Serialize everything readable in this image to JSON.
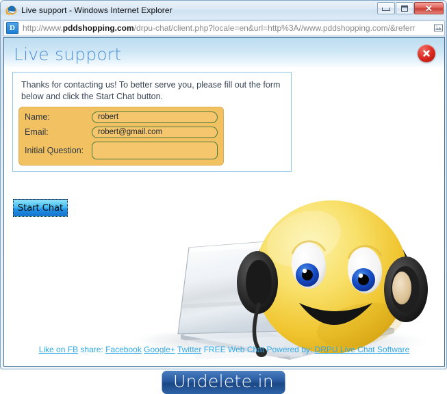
{
  "window": {
    "title": "Live support - Windows Internet Explorer",
    "favicon": "internet-explorer-icon",
    "buttons": {
      "minimize": "Minimize",
      "maximize": "Maximize",
      "close": "✕"
    }
  },
  "address_bar": {
    "favicon_letter": "D",
    "url_protocol": "http://www.",
    "url_domain": "pddshopping.com",
    "url_path": "/drpu-chat/client.php?locale=en&url=http%3A//www.pddshopping.com/&referr",
    "full_url": "http://www.pddshopping.com/drpu-chat/client.php?locale=en&url=http%3A//www.pddshopping.com/&referr",
    "right_icon": "compatibility-view-icon"
  },
  "chat": {
    "header_title": "Live support",
    "close_label": "Close",
    "intro_text": "Thanks for contacting us! To better serve you, please fill out the form below and click the Start Chat button.",
    "fields": [
      {
        "label": "Name:",
        "value": "robert",
        "placeholder": "",
        "name": "name-field"
      },
      {
        "label": "Email:",
        "value": "robert@gmail.com",
        "placeholder": "",
        "name": "email-field"
      },
      {
        "label": "Initial Question:",
        "value": "",
        "placeholder": "",
        "name": "initial-question-field"
      }
    ],
    "start_button": "Start Chat"
  },
  "footer": {
    "like_label": "Like on FB",
    "share_label": "share:",
    "facebook": "Facebook",
    "googleplus": "Google+",
    "twitter": "Twitter",
    "free_chat_text": "FREE Web Chat Powered by:",
    "powered_by_link": "DRPU Live Chat Software"
  },
  "banner": {
    "text": "Undelete.in"
  },
  "colors": {
    "header_blue": "#4f8fd0",
    "link_blue": "#2fa8e8",
    "form_amber": "#f2c161",
    "field_border_green": "#4c7a3d",
    "close_red": "#d8261c",
    "banner_blue": "#27589e",
    "panel_border": "#8ec5e8"
  }
}
